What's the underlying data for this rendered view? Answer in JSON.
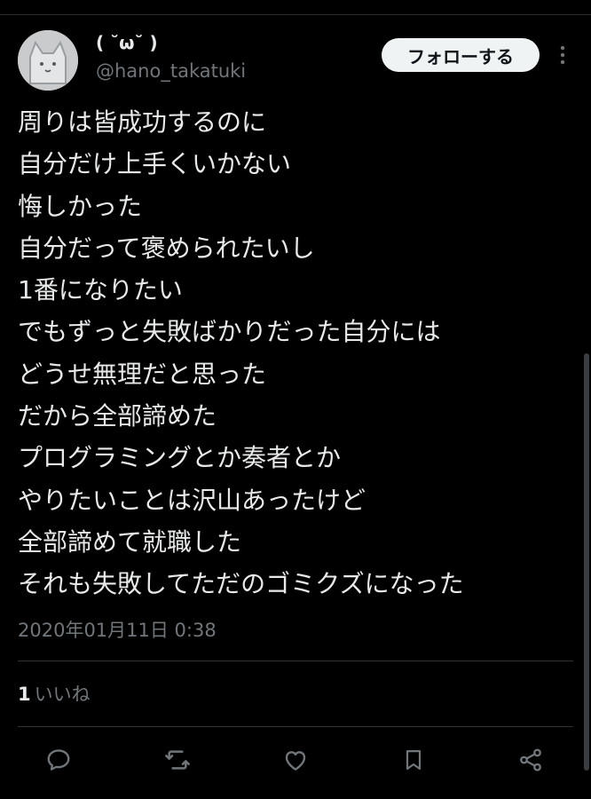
{
  "user": {
    "display_name": "( ˘ω˘ )",
    "handle": "@hano_takatuki"
  },
  "follow_button": {
    "label": "フォローする"
  },
  "tweet": {
    "lines": [
      "周りは皆成功するのに",
      "自分だけ上手くいかない",
      "悔しかった",
      "自分だって褒められたいし",
      "1番になりたい",
      "でもずっと失敗ばかりだった自分には",
      "どうせ無理だと思った",
      "だから全部諦めた",
      "プログラミングとか奏者とか",
      "やりたいことは沢山あったけど",
      "全部諦めて就職した",
      "それも失敗してただのゴミクズになった"
    ],
    "timestamp": "2020年01月11日 0:38"
  },
  "stats": {
    "likes_count": "1",
    "likes_label": "いいね"
  },
  "actions": [
    {
      "name": "reply-icon"
    },
    {
      "name": "retweet-icon"
    },
    {
      "name": "like-icon"
    },
    {
      "name": "bookmark-icon"
    },
    {
      "name": "share-icon"
    }
  ],
  "colors": {
    "background": "#000000",
    "text_primary": "#e7e9ea",
    "text_secondary": "#71767b",
    "divider": "#2f3336",
    "follow_button_bg": "#eff3f4",
    "follow_button_text": "#0f1419"
  }
}
